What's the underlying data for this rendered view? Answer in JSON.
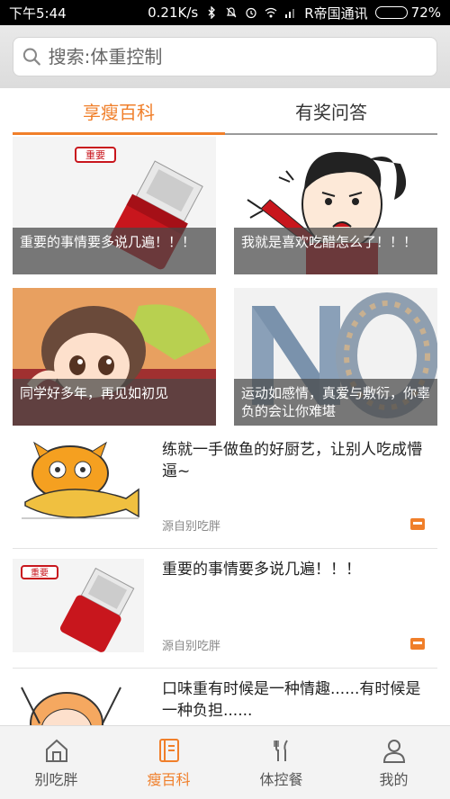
{
  "status_bar": {
    "time": "下午5:44",
    "net_speed": "0.21K/s",
    "carrier": "R帝国通讯",
    "battery_percent": "72%",
    "battery_level": 0.72
  },
  "search": {
    "placeholder": "搜索:体重控制"
  },
  "tabs": [
    {
      "label": "享瘦百科",
      "active": true
    },
    {
      "label": "有奖问答",
      "active": false
    }
  ],
  "grid_cards": [
    {
      "caption": "重要的事情要多说几遍！！！",
      "image": "red-stamp-important",
      "stamp_text": "重要"
    },
    {
      "caption": "我就是喜欢吃醋怎么了！！！",
      "image": "angry-cartoon-girl"
    },
    {
      "caption": "同学好多年，再见如初见",
      "image": "crying-anime-girl"
    },
    {
      "caption": "运动如感情，真爱与敷衍，你辜负的会让你难堪",
      "image": "puzzle-no-letters"
    }
  ],
  "list_items": [
    {
      "title": "练就一手做鱼的好厨艺，让别人吃成懵逼~",
      "source": "源自别吃胖",
      "image": "cartoon-cat-fish"
    },
    {
      "title": "重要的事情要多说几遍！！！",
      "source": "源自别吃胖",
      "image": "red-stamp-important",
      "stamp_text": "重要"
    },
    {
      "title": "口味重有时候是一种情趣......有时候是一种负担......",
      "source": "",
      "image": "cartoon-chef"
    }
  ],
  "bottom_nav": [
    {
      "label": "别吃胖",
      "icon": "home-icon",
      "active": false
    },
    {
      "label": "瘦百科",
      "icon": "book-icon",
      "active": true
    },
    {
      "label": "体控餐",
      "icon": "utensils-icon",
      "active": false
    },
    {
      "label": "我的",
      "icon": "user-icon",
      "active": false
    }
  ],
  "colors": {
    "accent": "#f07f2a",
    "caption_overlay": "#464646",
    "stamp_red": "#c8161d"
  }
}
